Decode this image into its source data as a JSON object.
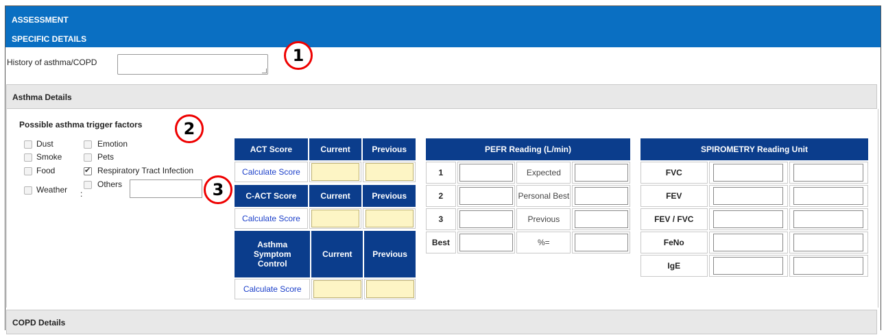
{
  "header": {
    "title": "ASSESSMENT",
    "subtitle": "SPECIFIC DETAILS"
  },
  "history": {
    "label": "History of asthma/COPD",
    "value": ""
  },
  "annotations": [
    "1",
    "2",
    "3"
  ],
  "asthma": {
    "section_title": "Asthma Details",
    "triggers_title": "Possible asthma trigger factors",
    "triggers": [
      {
        "label": "Dust",
        "checked": false
      },
      {
        "label": "Smoke",
        "checked": false
      },
      {
        "label": "Food",
        "checked": false
      },
      {
        "label": "Weather",
        "checked": false
      },
      {
        "label": "Emotion",
        "checked": false
      },
      {
        "label": "Pets",
        "checked": false
      },
      {
        "label": "Respiratory Tract Infection",
        "checked": true
      },
      {
        "label": "Others",
        "checked": false
      }
    ],
    "others_colon": ":",
    "score_tables": [
      {
        "title": "ACT Score",
        "current": "Current",
        "previous": "Previous",
        "link": "Calculate Score"
      },
      {
        "title": "C-ACT Score",
        "current": "Current",
        "previous": "Previous",
        "link": "Calculate Score"
      },
      {
        "title": "Asthma Symptom Control",
        "current": "Current",
        "previous": "Previous",
        "link": "Calculate Score"
      }
    ],
    "pefr": {
      "title": "PEFR Reading (L/min)",
      "rows": [
        {
          "label": "1",
          "right_label": "Expected"
        },
        {
          "label": "2",
          "right_label": "Personal Best"
        },
        {
          "label": "3",
          "right_label": "Previous"
        },
        {
          "label": "Best",
          "right_label": "%="
        }
      ]
    },
    "spirometry": {
      "title": "SPIROMETRY Reading Unit",
      "rows": [
        "FVC",
        "FEV",
        "FEV / FVC",
        "FeNo",
        "IgE"
      ]
    }
  },
  "copd": {
    "section_title": "COPD Details"
  }
}
